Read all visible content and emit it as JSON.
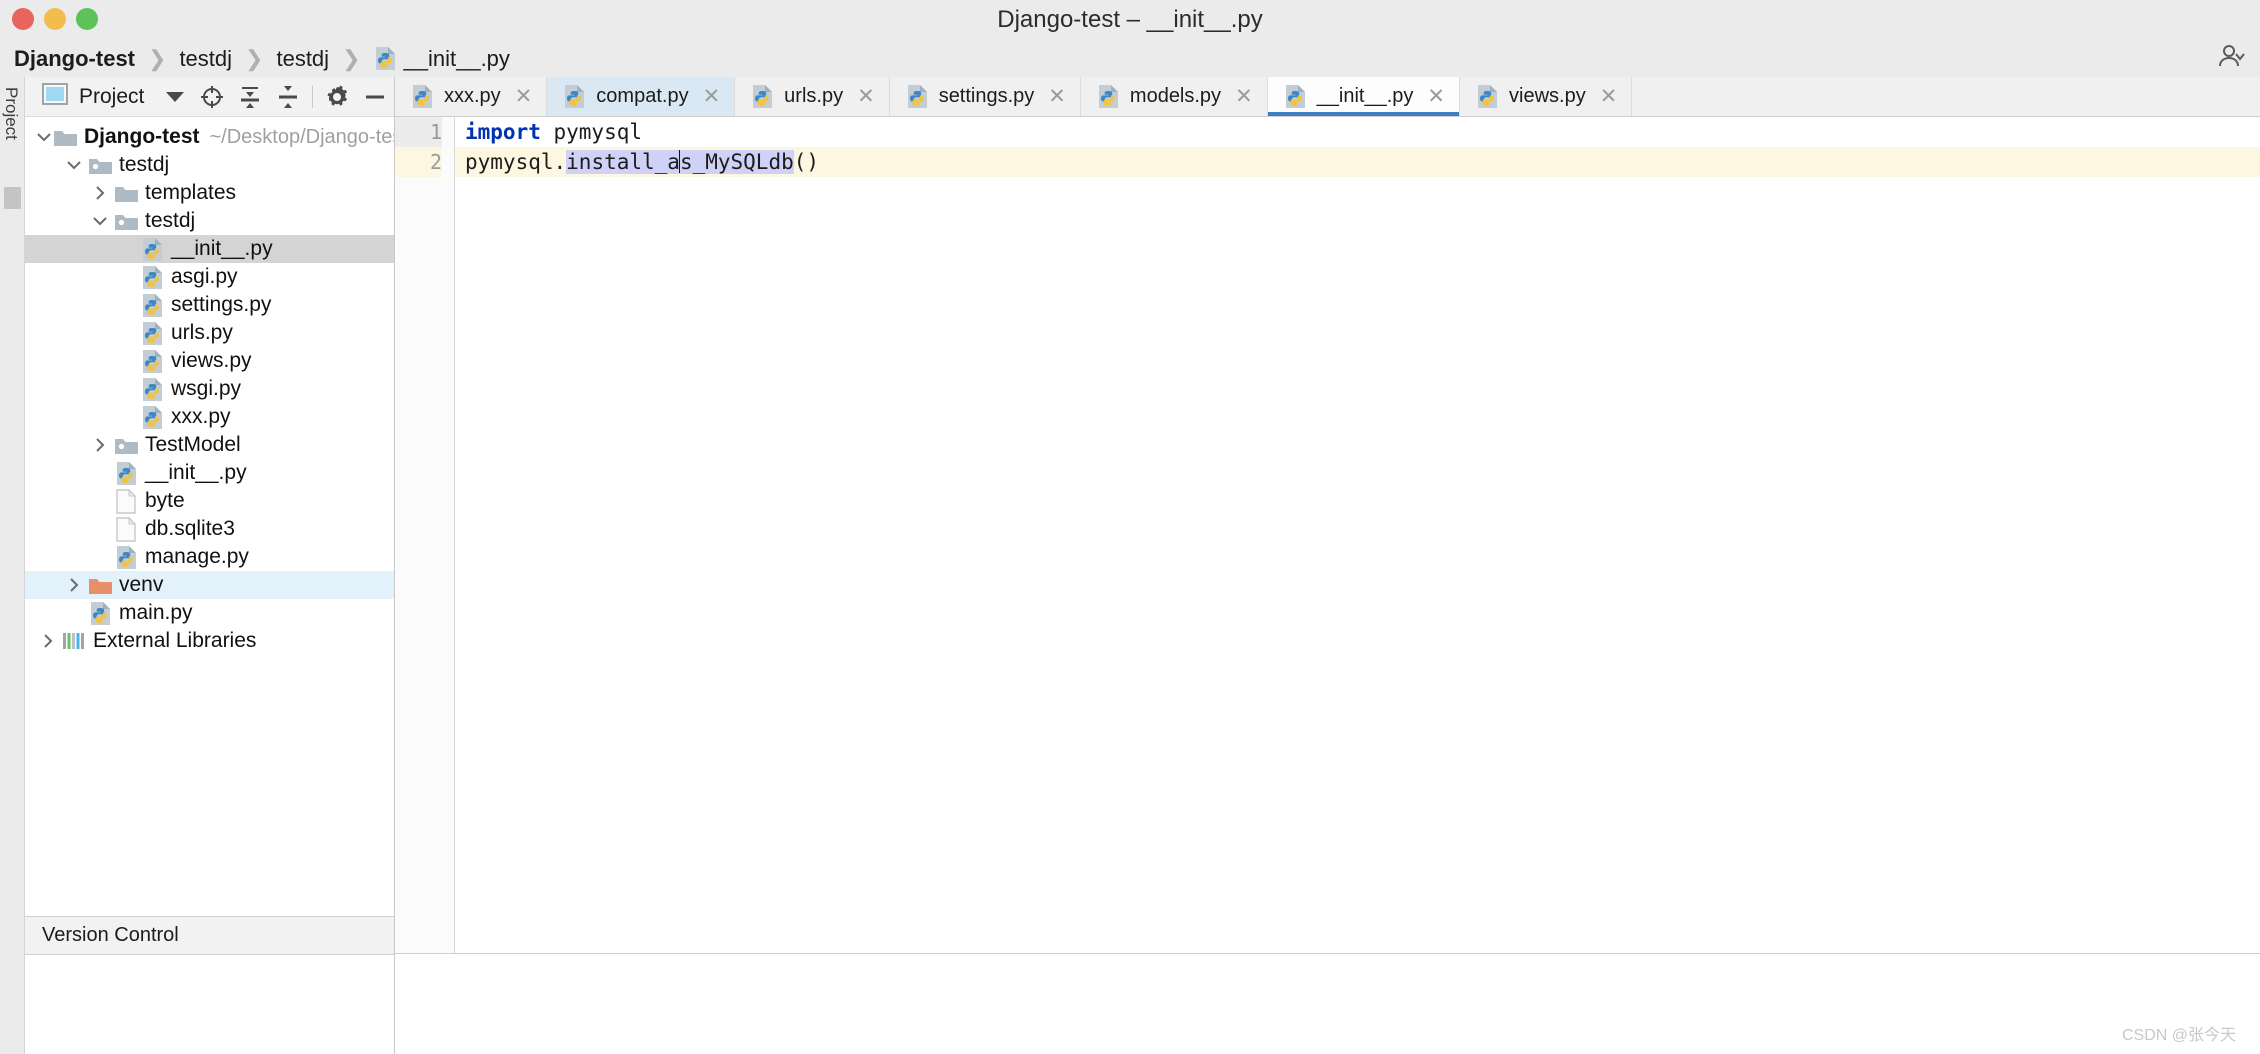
{
  "window": {
    "title": "Django-test – __init__.py",
    "traffic_lights": [
      "close",
      "minimize",
      "maximize"
    ]
  },
  "breadcrumb": {
    "items": [
      {
        "label": "Django-test",
        "bold": true,
        "icon": ""
      },
      {
        "label": "testdj",
        "bold": false,
        "icon": ""
      },
      {
        "label": "testdj",
        "bold": false,
        "icon": ""
      },
      {
        "label": "__init__.py",
        "bold": false,
        "icon": "python-file-icon"
      }
    ],
    "separator": "❯",
    "account_icon": "user-account-icon"
  },
  "tool_window_strip": {
    "label": "Project"
  },
  "project_panel": {
    "title": "Project",
    "dropdown_icon": "chevron-down-icon",
    "toolbar_buttons": [
      {
        "name": "select-opened-file-icon",
        "tooltip": "Select Opened File"
      },
      {
        "name": "expand-all-icon",
        "tooltip": "Expand All"
      },
      {
        "name": "collapse-all-icon",
        "tooltip": "Collapse All"
      },
      {
        "name": "settings-gear-icon",
        "tooltip": "Settings"
      },
      {
        "name": "hide-icon",
        "tooltip": "Hide"
      }
    ],
    "tree": [
      {
        "label": "Django-test",
        "path": "~/Desktop/Django-test",
        "indent": 0,
        "twisty": "down",
        "icon": "folder-icon",
        "bold": true,
        "state": "none"
      },
      {
        "label": "testdj",
        "path": "",
        "indent": 1,
        "twisty": "down",
        "icon": "source-folder-icon",
        "bold": false,
        "state": "none"
      },
      {
        "label": "templates",
        "path": "",
        "indent": 2,
        "twisty": "right",
        "icon": "folder-icon",
        "bold": false,
        "state": "none"
      },
      {
        "label": "testdj",
        "path": "",
        "indent": 2,
        "twisty": "down",
        "icon": "source-folder-icon",
        "bold": false,
        "state": "none"
      },
      {
        "label": "__init__.py",
        "path": "",
        "indent": 3,
        "twisty": "none",
        "icon": "python-file-icon",
        "bold": false,
        "state": "selected"
      },
      {
        "label": "asgi.py",
        "path": "",
        "indent": 3,
        "twisty": "none",
        "icon": "python-file-icon",
        "bold": false,
        "state": "none"
      },
      {
        "label": "settings.py",
        "path": "",
        "indent": 3,
        "twisty": "none",
        "icon": "python-file-icon",
        "bold": false,
        "state": "none"
      },
      {
        "label": "urls.py",
        "path": "",
        "indent": 3,
        "twisty": "none",
        "icon": "python-file-icon",
        "bold": false,
        "state": "none"
      },
      {
        "label": "views.py",
        "path": "",
        "indent": 3,
        "twisty": "none",
        "icon": "python-file-icon",
        "bold": false,
        "state": "none"
      },
      {
        "label": "wsgi.py",
        "path": "",
        "indent": 3,
        "twisty": "none",
        "icon": "python-file-icon",
        "bold": false,
        "state": "none"
      },
      {
        "label": "xxx.py",
        "path": "",
        "indent": 3,
        "twisty": "none",
        "icon": "python-file-icon",
        "bold": false,
        "state": "none"
      },
      {
        "label": "TestModel",
        "path": "",
        "indent": 2,
        "twisty": "right",
        "icon": "source-folder-icon",
        "bold": false,
        "state": "none"
      },
      {
        "label": "__init__.py",
        "path": "",
        "indent": 2,
        "twisty": "none",
        "icon": "python-file-icon",
        "bold": false,
        "state": "none"
      },
      {
        "label": "byte",
        "path": "",
        "indent": 2,
        "twisty": "none",
        "icon": "file-icon",
        "bold": false,
        "state": "none"
      },
      {
        "label": "db.sqlite3",
        "path": "",
        "indent": 2,
        "twisty": "none",
        "icon": "file-icon",
        "bold": false,
        "state": "none"
      },
      {
        "label": "manage.py",
        "path": "",
        "indent": 2,
        "twisty": "none",
        "icon": "python-file-icon",
        "bold": false,
        "state": "none"
      },
      {
        "label": "venv",
        "path": "",
        "indent": 1,
        "twisty": "right",
        "icon": "excluded-folder-icon",
        "bold": false,
        "state": "highlighted"
      },
      {
        "label": "main.py",
        "path": "",
        "indent": 1,
        "twisty": "none",
        "icon": "python-file-icon",
        "bold": false,
        "state": "none"
      },
      {
        "label": "External Libraries",
        "path": "",
        "indent": 0,
        "twisty": "right",
        "icon": "libraries-icon",
        "bold": false,
        "state": "none"
      }
    ]
  },
  "editor": {
    "tabs": [
      {
        "label": "xxx.py",
        "icon": "python-file-icon",
        "state": "normal",
        "close_icon": "close-icon"
      },
      {
        "label": "compat.py",
        "icon": "python-file-icon",
        "state": "modified",
        "close_icon": "close-icon"
      },
      {
        "label": "urls.py",
        "icon": "python-file-icon",
        "state": "normal",
        "close_icon": "close-icon"
      },
      {
        "label": "settings.py",
        "icon": "python-file-icon",
        "state": "normal",
        "close_icon": "close-icon"
      },
      {
        "label": "models.py",
        "icon": "python-file-icon",
        "state": "normal",
        "close_icon": "close-icon"
      },
      {
        "label": "__init__.py",
        "icon": "python-file-icon",
        "state": "active",
        "close_icon": "close-icon"
      },
      {
        "label": "views.py",
        "icon": "python-file-icon",
        "state": "normal",
        "close_icon": "close-icon"
      }
    ],
    "gutter_numbers": [
      "1",
      "2"
    ],
    "code": {
      "line1_keyword": "import",
      "line1_rest": " pymysql",
      "line2_prefix": "pymysql.",
      "line2_sel_before_caret": "install_a",
      "line2_sel_after_caret": "s_MySQLdb",
      "line2_suffix": "()"
    }
  },
  "status": {
    "version_control": "Version Control"
  },
  "watermark": "CSDN @张今天",
  "colors": {
    "accent_tab_underline": "#3e7fc1",
    "tree_selected": "#d4d4d4",
    "tree_highlight": "#e3f1fb",
    "modified_tab": "#d9e8f2",
    "keyword": "#0033b3",
    "selection": "#cfd1f7",
    "current_line": "#fdf7e2",
    "venv_folder": "#e8906b"
  }
}
